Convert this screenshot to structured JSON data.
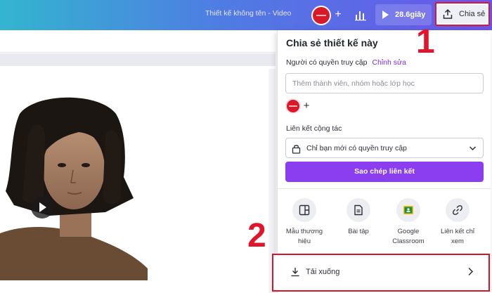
{
  "topbar": {
    "doc_title": "Thiết kế không tên - Video",
    "duration": "28.6giây",
    "share_label": "Chia sẻ"
  },
  "share_panel": {
    "title": "Chia sẻ thiết kế này",
    "access_label": "Người có quyền truy cập",
    "edit_link": "Chỉnh sửa",
    "member_placeholder": "Thêm thành viên, nhóm hoặc lớp học",
    "collab_label": "Liên kết cộng tác",
    "access_value": "Chỉ bạn mới có quyền truy cập",
    "copy_button": "Sao chép liên kết",
    "options": [
      {
        "line1": "Mẫu thương",
        "line2": "hiệu",
        "icon": "template-icon"
      },
      {
        "line1": "Bài tập",
        "line2": "",
        "icon": "assignment-icon"
      },
      {
        "line1": "Google",
        "line2": "Classroom",
        "icon": "google-classroom-icon"
      },
      {
        "line1": "Liên kết chỉ",
        "line2": "xem",
        "icon": "link-icon"
      }
    ],
    "download_label": "Tải xuống"
  },
  "annotations": {
    "step1": "1",
    "step2": "2"
  },
  "colors": {
    "accent_purple": "#8b3df0",
    "highlight_red": "#e0152b"
  }
}
